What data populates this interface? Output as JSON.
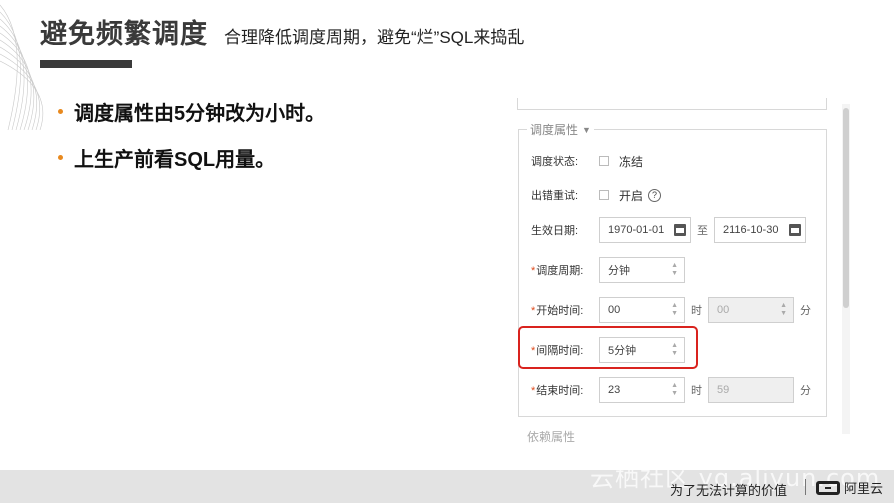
{
  "header": {
    "title": "避免频繁调度",
    "subtitle": "合理降低调度周期，避免“烂”SQL来捣乱"
  },
  "bullets": [
    "调度属性由5分钟改为小时。",
    "上生产前看SQL用量。"
  ],
  "form": {
    "legend": "调度属性",
    "status_label": "调度状态:",
    "status_option": "冻结",
    "retry_label": "出错重试:",
    "retry_option": "开启",
    "retry_help": "?",
    "date_label": "生效日期:",
    "date_start": "1970-01-01",
    "date_to": "至",
    "date_end": "2116-10-30",
    "cycle_label": "调度周期:",
    "cycle_value": "分钟",
    "start_label": "开始时间:",
    "start_hour": "00",
    "hour_unit": "时",
    "start_minute": "00",
    "minute_unit": "分",
    "interval_label": "间隔时间:",
    "interval_value": "5分钟",
    "end_label": "结束时间:",
    "end_hour": "23",
    "end_minute": "59",
    "required_mark": "*",
    "next_legend": "依赖属性"
  },
  "footer": {
    "watermark": "云栖社区 yq.aliyun.com",
    "slogan": "为了无法计算的价值",
    "logo_text": "阿里云"
  },
  "colors": {
    "accent_bullet": "#e8891e",
    "highlight": "#d9231e",
    "required": "#e04a1b"
  }
}
